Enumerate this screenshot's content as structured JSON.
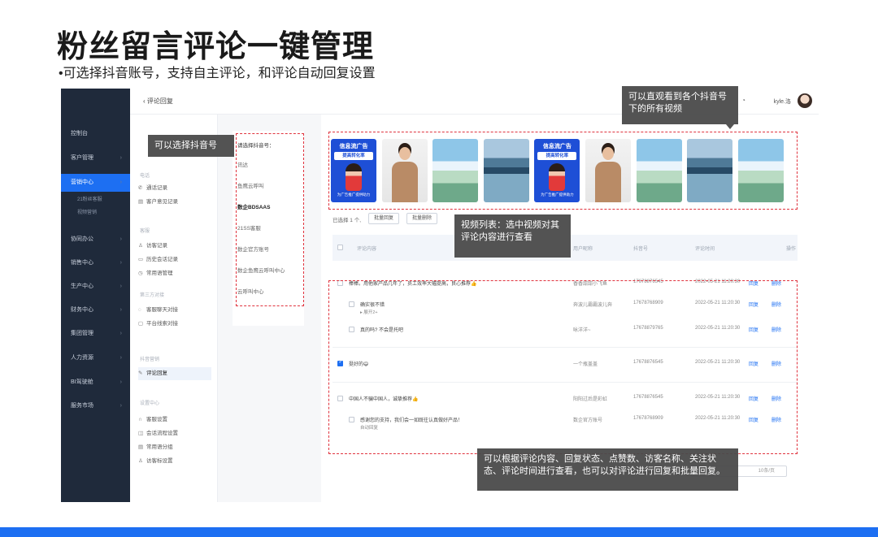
{
  "slide": {
    "title": "粉丝留言评论一键管理",
    "subtitle": "•可选择抖音账号，支持自主评论，和评论自动回复设置"
  },
  "topbar": {
    "back_label": "评论回复",
    "user_name": "kyle.洛"
  },
  "sidebar": {
    "items": [
      {
        "label": "控制台"
      },
      {
        "label": "客户管理"
      },
      {
        "label": "营销中心"
      },
      {
        "label": "协同办公"
      },
      {
        "label": "销售中心"
      },
      {
        "label": "生产中心"
      },
      {
        "label": "财务中心"
      },
      {
        "label": "集团管理"
      },
      {
        "label": "人力资源"
      },
      {
        "label": "BI驾驶舱"
      },
      {
        "label": "服务市场"
      }
    ],
    "sub_items": [
      {
        "label": "21粉丝客服"
      },
      {
        "label": "视频营销"
      }
    ]
  },
  "menu2": {
    "groups": [
      {
        "label": "电话"
      },
      {
        "label": "客服"
      },
      {
        "label": "第三方对接"
      },
      {
        "label": "抖音营销"
      },
      {
        "label": "设置中心"
      }
    ],
    "items": [
      {
        "label": "通话记录"
      },
      {
        "label": "客户意见记录"
      },
      {
        "label": "访客记录"
      },
      {
        "label": "历史会话记录"
      },
      {
        "label": "常用语管理"
      },
      {
        "label": "客服聊天对接"
      },
      {
        "label": "平台线索对接"
      },
      {
        "label": "评论回复"
      },
      {
        "label": "客服设置"
      },
      {
        "label": "会话流程设置"
      },
      {
        "label": "常用语分组"
      },
      {
        "label": "访客标设置"
      }
    ]
  },
  "account_panel": {
    "title": "请选择抖音号：",
    "accounts": [
      {
        "label": "讯达"
      },
      {
        "label": "鱼鹰云呼叫"
      },
      {
        "label": "数企BDSAAS"
      },
      {
        "label": "21SS客服"
      },
      {
        "label": "数企官方账号"
      },
      {
        "label": "数企鱼鹰云呼叫中心"
      },
      {
        "label": "云呼叫中心"
      }
    ]
  },
  "videos": [
    {
      "type": "ad",
      "line1": "信息流广告",
      "line2": "提高转化率",
      "line3": "为广告推广提供助力"
    },
    {
      "type": "person"
    },
    {
      "type": "sky"
    },
    {
      "type": "lake"
    },
    {
      "type": "ad",
      "line1": "信息流广告",
      "line2": "提高转化率",
      "line3": "为广告推广提供助力"
    },
    {
      "type": "person"
    },
    {
      "type": "sky"
    },
    {
      "type": "lake"
    },
    {
      "type": "sky"
    }
  ],
  "toolbar": {
    "selected_text": "已选择 1 个,",
    "batch_reply": "批量回复",
    "batch_delete": "批量删除"
  },
  "table": {
    "headers": [
      "评论内容",
      "用户昵称",
      "抖音号",
      "评论时间",
      "操作"
    ],
    "rows": [
      {
        "content": "棒棒。用他家产品几年了，员工效率大幅提高，良心推荐👍",
        "nick": "香香甜甜小飞鱼",
        "uid": "17678876545",
        "time": "2022-05-21 11:20:30",
        "reply": "回复",
        "del": "删除",
        "indent": 0,
        "checked": false
      },
      {
        "content": "确实很不错",
        "extra": "▸ 展开2+",
        "nick": "奔波儿霸霸波儿奔",
        "uid": "17678768909",
        "time": "2022-05-21 11:20:30",
        "reply": "回复",
        "del": "删除",
        "indent": 1,
        "checked": false
      },
      {
        "content": "真的吗? 不会是托吧",
        "nick": "咏洋洋~",
        "uid": "17678879765",
        "time": "2022-05-21 11:20:30",
        "reply": "回复",
        "del": "删除",
        "indent": 1,
        "checked": false
      },
      {
        "content": "挺好的😄",
        "nick": "一个瓶盖盖",
        "uid": "17678876545",
        "time": "2022-05-21 11:20:30",
        "reply": "回复",
        "del": "删除",
        "indent": 0,
        "checked": true
      },
      {
        "content": "中国人不骗中国人，诚挚推荐👍",
        "nick": "阳阳过后是彩虹",
        "uid": "17678876545",
        "time": "2022-05-21 11:20:30",
        "reply": "回复",
        "del": "删除",
        "indent": 0,
        "checked": false
      },
      {
        "content": "感谢您的支持，我们会一如既往认真做好产品！",
        "extra": "自动回复",
        "nick": "数企官方账号",
        "uid": "17678768909",
        "time": "2022-05-21 11:20:30",
        "reply": "回复",
        "del": "删除",
        "indent": 1,
        "checked": false
      }
    ]
  },
  "pager": {
    "label": "10条/页"
  },
  "annotations": {
    "account_tip": "可以选择抖音号",
    "videos_tip": "可以直观看到各个抖音号下的所有视频",
    "list_tip": "视频列表：选中视频对其评论内容进行查看",
    "filter_tip": "可以根据评论内容、回复状态、点赞数、访客名称、关注状态、评论时间进行查看，也可以对评论进行回复和批量回复。"
  },
  "colors": {
    "accent": "#1d6ff2",
    "sidebar_bg": "#1f2a3b",
    "annotation_border": "#e0333e",
    "tooltip_bg": "#4a4a4a"
  }
}
